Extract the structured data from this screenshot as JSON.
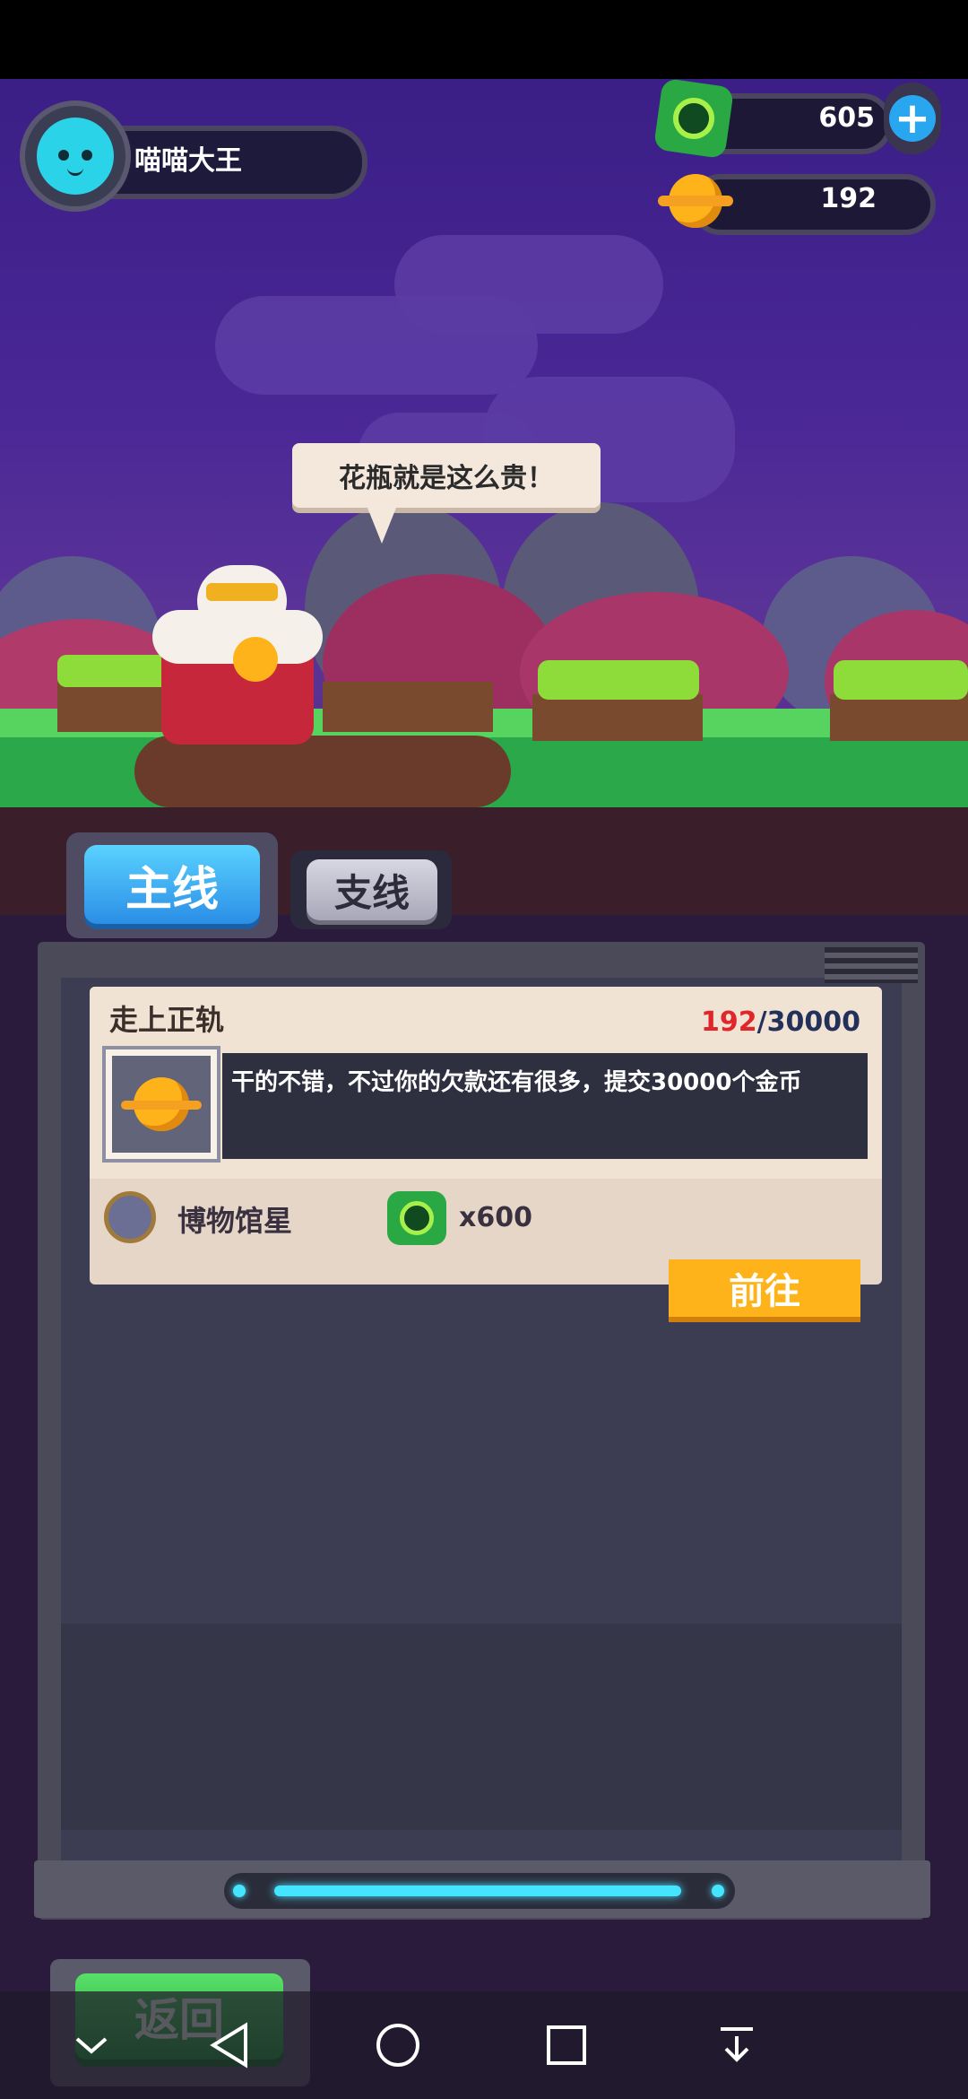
{
  "player": {
    "name": "喵喵大王"
  },
  "resources": {
    "gems": "605",
    "coins": "192"
  },
  "speech": {
    "text": "花瓶就是这么贵！"
  },
  "tabs": {
    "main": "主线",
    "side": "支线"
  },
  "quest": {
    "title": "走上正轨",
    "progress_current": "192",
    "progress_separator": "/",
    "progress_total": "30000",
    "description": "干的不错，不过你的欠款还有很多，提交30000个金币",
    "reward_location": "博物馆星",
    "reward_quantity": "x600",
    "go_label": "前往"
  },
  "back_button": {
    "label": "返回"
  },
  "colors": {
    "accent_blue": "#2b8ee6",
    "gold": "#ffb31a",
    "green": "#22a638",
    "cyan": "#45e5ff"
  }
}
